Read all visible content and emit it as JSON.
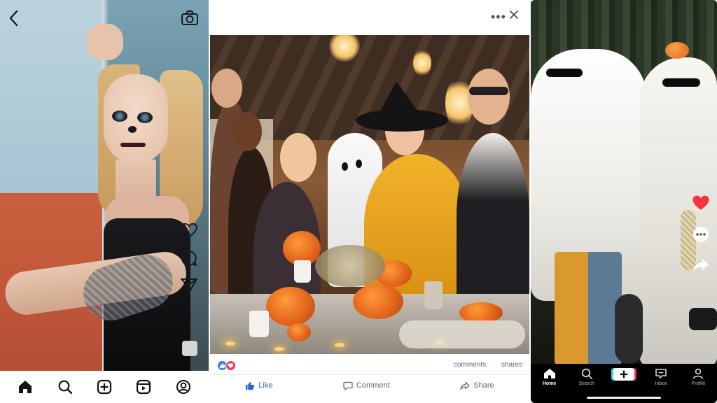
{
  "instagram": {
    "icons": {
      "back": "back-arrow-icon",
      "camera": "camera-icon",
      "like": "heart-outline-icon",
      "comment": "comment-bubble-icon",
      "share": "paper-plane-icon"
    },
    "nav": [
      {
        "name": "home-icon"
      },
      {
        "name": "search-icon"
      },
      {
        "name": "create-plus-icon"
      },
      {
        "name": "reels-icon"
      },
      {
        "name": "profile-icon"
      }
    ]
  },
  "facebook": {
    "header": {
      "more": "•••"
    },
    "meta": {
      "comments": "comments",
      "shares": "shares"
    },
    "actions": {
      "like": "Like",
      "comment": "Comment",
      "share": "Share"
    },
    "colors": {
      "like_blue": "#2f5fd8",
      "love_red": "#f33e58",
      "muted": "#65676b"
    }
  },
  "tiktok": {
    "tabs": [
      {
        "label": "Home",
        "active": true
      },
      {
        "label": "Search",
        "active": false
      },
      {
        "label": "",
        "active": false
      },
      {
        "label": "Inbox",
        "active": false
      },
      {
        "label": "Profile",
        "active": false
      }
    ],
    "side": {
      "like_color": "#f5343f"
    }
  }
}
